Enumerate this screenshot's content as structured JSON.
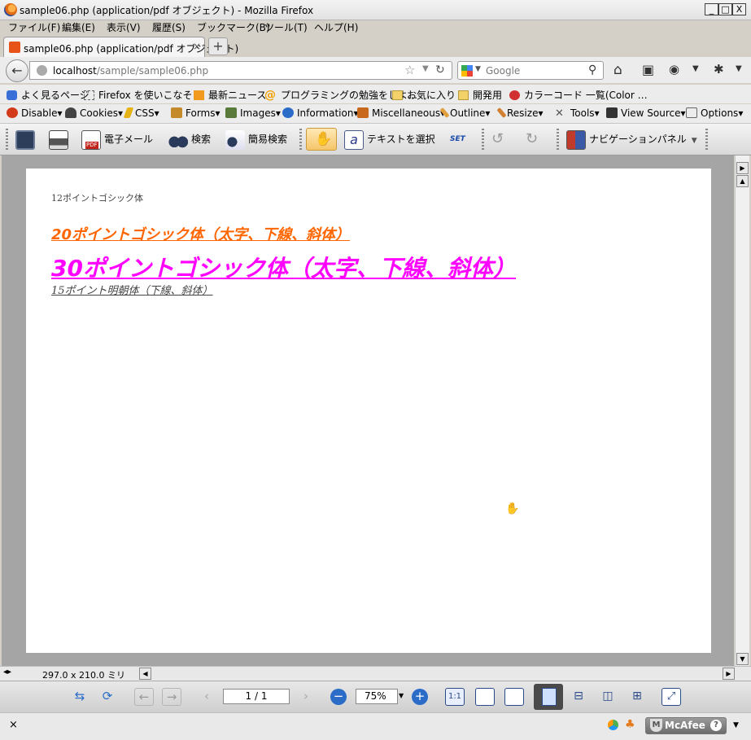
{
  "window": {
    "title": "sample06.php (application/pdf オブジェクト) - Mozilla Firefox",
    "minimize": "_",
    "maximize": "□",
    "close": "X"
  },
  "menubar": [
    "ファイル(F)",
    "編集(E)",
    "表示(V)",
    "履歴(S)",
    "ブックマーク(B)",
    "ツール(T)",
    "ヘルプ(H)"
  ],
  "tabs": [
    {
      "label": "sample06.php (application/pdf オブジェクト)",
      "close": "×"
    }
  ],
  "new_tab": "+",
  "navbar": {
    "back": "←",
    "url_host": "localhost",
    "url_path": "/sample/sample06.php",
    "search_placeholder": "Google"
  },
  "bookmarks": [
    {
      "label": "よく見るページ",
      "icon": "mostvisited-icon",
      "color": "#3a6fd8"
    },
    {
      "label": "Firefox を使いこなそう",
      "icon": "page-icon",
      "color": "#ffffff"
    },
    {
      "label": "最新ニュース",
      "icon": "rss-icon",
      "color": "#f29a1e"
    },
    {
      "label": "プログラミングの勉強をしよ…",
      "icon": "at-icon",
      "color": "#f0a000"
    },
    {
      "label": "お気に入り",
      "icon": "folder-icon",
      "color": "#f4d26a"
    },
    {
      "label": "開発用",
      "icon": "folder-icon",
      "color": "#f4d26a"
    },
    {
      "label": "カラーコード 一覧(Color …",
      "icon": "color-icon",
      "color": "#d23030"
    }
  ],
  "webdev_toolbar": [
    {
      "label": "Disable",
      "icon": "disable-icon",
      "color": "#d23a1a"
    },
    {
      "label": "Cookies",
      "icon": "cookies-icon",
      "color": "#444444"
    },
    {
      "label": "CSS",
      "icon": "css-icon",
      "color": "#e5b316"
    },
    {
      "label": "Forms",
      "icon": "forms-icon",
      "color": "#c48a2a"
    },
    {
      "label": "Images",
      "icon": "images-icon",
      "color": "#5a7a3a"
    },
    {
      "label": "Information",
      "icon": "info-icon",
      "color": "#2a6cc8"
    },
    {
      "label": "Miscellaneous",
      "icon": "misc-icon",
      "color": "#c8681a"
    },
    {
      "label": "Outline",
      "icon": "outline-icon",
      "color": "#e0a040"
    },
    {
      "label": "Resize",
      "icon": "resize-icon",
      "color": "#d08030"
    },
    {
      "label": "Tools",
      "icon": "tools-icon",
      "color": "#555555"
    },
    {
      "label": "View Source",
      "icon": "viewsource-icon",
      "color": "#333333"
    },
    {
      "label": "Options",
      "icon": "options-icon",
      "color": "#666666"
    }
  ],
  "pdf_toolbar": {
    "email": "電子メール",
    "search": "検索",
    "quick_search": "簡易検索",
    "select_text": "テキストを選択",
    "set_label": "SET",
    "nav_panel": "ナビゲーションパネル"
  },
  "document": {
    "line_12": "12ポイントゴシック体",
    "line_20": "20ポイントゴシック体（太字、下線、斜体）",
    "line_30": "30ポイントゴシック体（太字、下線、斜体）",
    "line_15": "15ポイント明朝体（下線、斜体）",
    "colors": {
      "orange": "#ff6600",
      "magenta": "#ff00ff"
    }
  },
  "status": {
    "page_size": "297.0 x 210.0 ミリ"
  },
  "pdf_nav": {
    "page": "1 / 1",
    "zoom": "75%"
  },
  "addon_bar": {
    "close": "×",
    "mcafee": "McAfee",
    "help": "?"
  }
}
